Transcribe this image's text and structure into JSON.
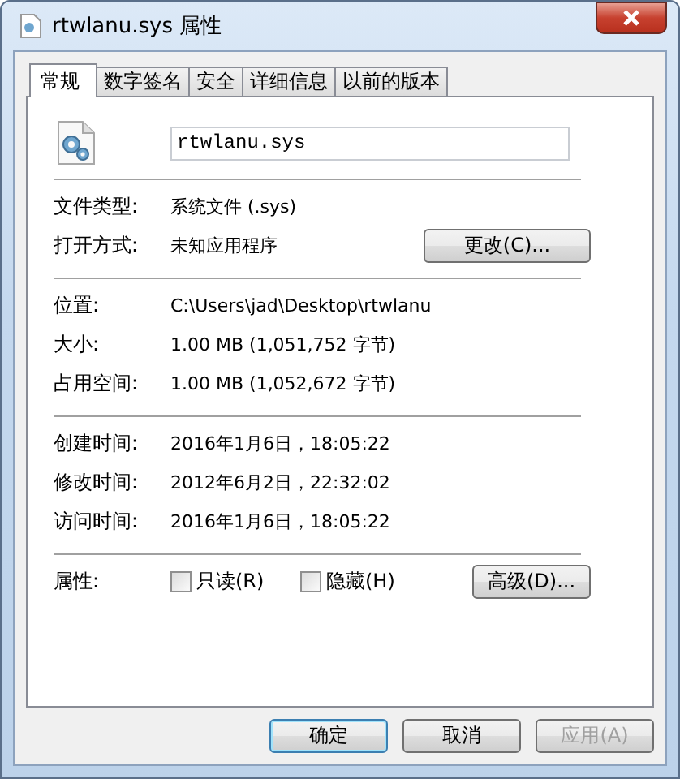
{
  "window": {
    "title": "rtwlanu.sys 属性"
  },
  "tabs": [
    {
      "label": "常规",
      "selected": true
    },
    {
      "label": "数字签名",
      "selected": false
    },
    {
      "label": "安全",
      "selected": false
    },
    {
      "label": "详细信息",
      "selected": false
    },
    {
      "label": "以前的版本",
      "selected": false
    }
  ],
  "file_name": "rtwlanu.sys",
  "sections": [
    [
      {
        "label": "文件类型:",
        "value": "系统文件 (.sys)",
        "kind": "text"
      },
      {
        "label": "打开方式:",
        "value": "未知应用程序",
        "kind": "button",
        "button": "更改(C)..."
      }
    ],
    [
      {
        "label": "位置:",
        "value": "C:\\Users\\jad\\Desktop\\rtwlanu",
        "kind": "text"
      },
      {
        "label": "大小:",
        "value": "1.00 MB (1,051,752 字节)",
        "kind": "text"
      },
      {
        "label": "占用空间:",
        "value": "1.00 MB (1,052,672 字节)",
        "kind": "text"
      }
    ],
    [
      {
        "label": "创建时间:",
        "value": "2016年1月6日，18:05:22",
        "kind": "text"
      },
      {
        "label": "修改时间:",
        "value": "2012年6月2日，22:32:02",
        "kind": "text"
      },
      {
        "label": "访问时间:",
        "value": "2016年1月6日，18:05:22",
        "kind": "text"
      }
    ]
  ],
  "attributes": {
    "label": "属性:",
    "options": [
      {
        "label": "只读(R)",
        "checked": false
      },
      {
        "label": "隐藏(H)",
        "checked": false
      }
    ],
    "advanced_button": "高级(D)..."
  },
  "buttons": [
    {
      "label": "确定",
      "default": true,
      "disabled": false
    },
    {
      "label": "取消",
      "default": false,
      "disabled": false
    },
    {
      "label": "应用(A)",
      "default": false,
      "disabled": true
    }
  ]
}
